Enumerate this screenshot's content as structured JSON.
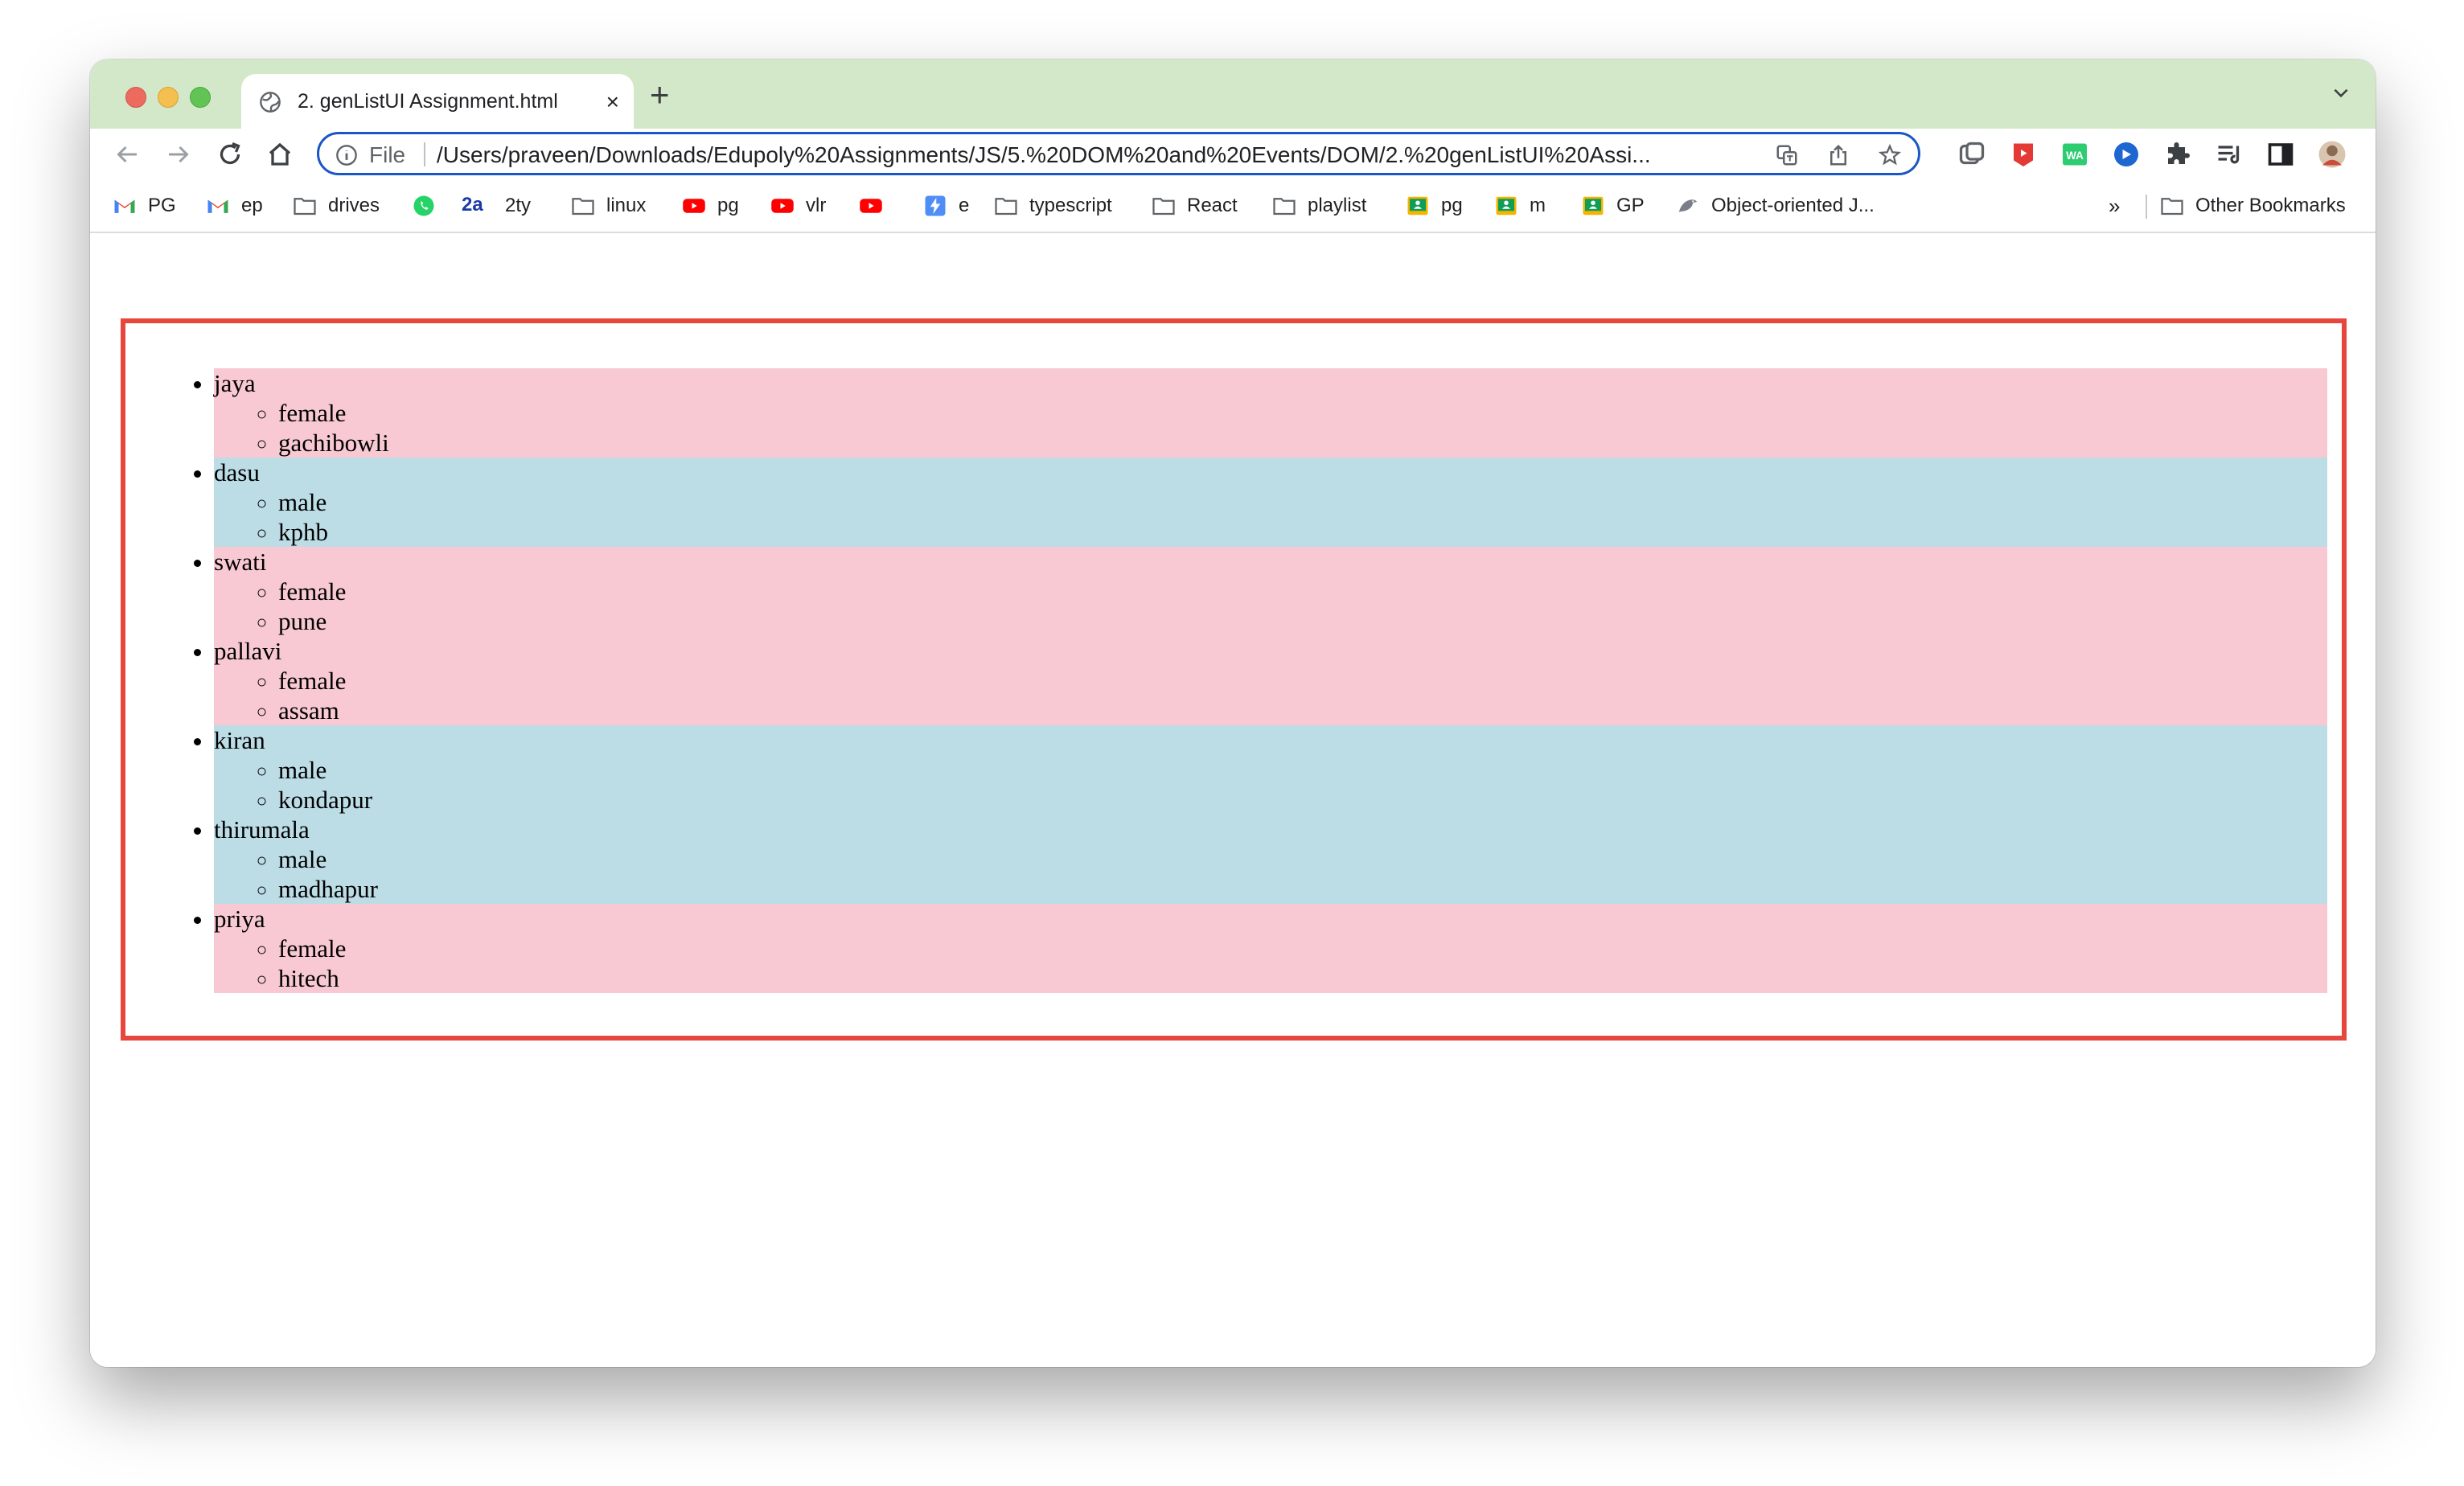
{
  "browser": {
    "tab": {
      "title": "2. genListUI Assignment.html",
      "favicon": "globe-icon",
      "close": "×"
    },
    "new_tab": "+",
    "tab_menu": "⌄",
    "omnibox": {
      "scheme_label": "File",
      "url": "/Users/praveen/Downloads/Edupoly%20Assignments/JS/5.%20DOM%20and%20Events/DOM/2.%20genListUI%20Assi..."
    },
    "accent_color": "#1a56c6",
    "tabstrip_color": "#d3e8c9"
  },
  "bookmarks": {
    "items": [
      {
        "label": "PG",
        "icon": "gmail-icon"
      },
      {
        "label": "ep",
        "icon": "gmail-icon"
      },
      {
        "label": "drives",
        "icon": "folder-icon"
      },
      {
        "label": "",
        "icon": "whatsapp-icon"
      },
      {
        "label": "2ty",
        "icon": "2a-icon",
        "icon_text": "2a"
      },
      {
        "label": "linux",
        "icon": "folder-icon"
      },
      {
        "label": "pg",
        "icon": "youtube-icon"
      },
      {
        "label": "vlr",
        "icon": "youtube-icon"
      },
      {
        "label": "",
        "icon": "youtube-icon"
      },
      {
        "label": "e",
        "icon": "bolt-icon"
      },
      {
        "label": "typescript",
        "icon": "folder-icon"
      },
      {
        "label": "React",
        "icon": "folder-icon"
      },
      {
        "label": "playlist",
        "icon": "folder-icon"
      },
      {
        "label": "pg",
        "icon": "classroom-icon"
      },
      {
        "label": "m",
        "icon": "classroom-icon"
      },
      {
        "label": "GP",
        "icon": "classroom-icon"
      },
      {
        "label": "Object-oriented J...",
        "icon": "bird-icon"
      }
    ],
    "overflow": "»",
    "other": "Other Bookmarks"
  },
  "page": {
    "border_color": "#e8453c",
    "female_color": "#f8c9d2",
    "male_color": "#bcdce6",
    "people": [
      {
        "name": "jaya",
        "gender": "female",
        "location": "gachibowli"
      },
      {
        "name": "dasu",
        "gender": "male",
        "location": "kphb"
      },
      {
        "name": "swati",
        "gender": "female",
        "location": "pune"
      },
      {
        "name": "pallavi",
        "gender": "female",
        "location": "assam"
      },
      {
        "name": "kiran",
        "gender": "male",
        "location": "kondapur"
      },
      {
        "name": "thirumala",
        "gender": "male",
        "location": "madhapur"
      },
      {
        "name": "priya",
        "gender": "female",
        "location": "hitech"
      }
    ]
  }
}
